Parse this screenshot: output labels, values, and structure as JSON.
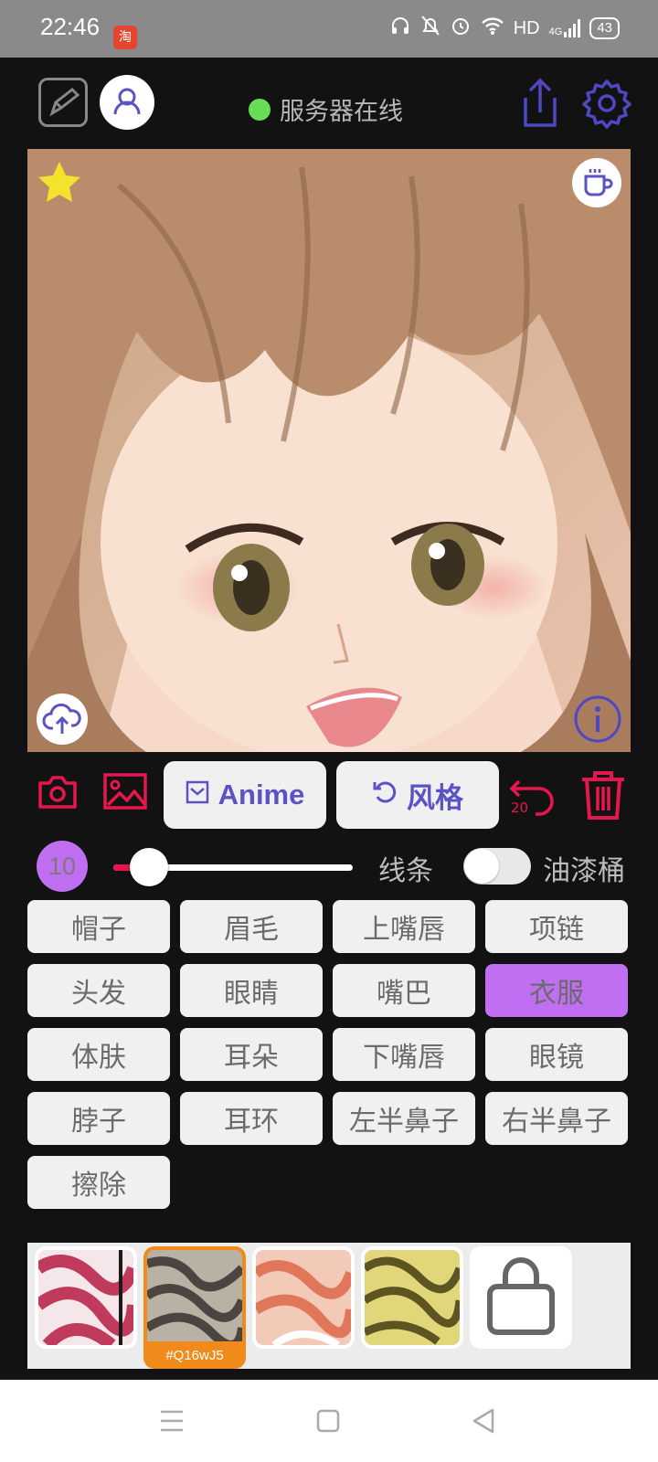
{
  "status_bar": {
    "time": "22:46",
    "app_icon_char": "淘",
    "network_label": "HD",
    "signal_label": "4G",
    "battery": "43"
  },
  "header": {
    "server_status": "服务器在线",
    "server_status_color": "#66dd55"
  },
  "colors": {
    "accent_blue": "#5b53c4",
    "accent_red": "#e8164d",
    "accent_purple": "#c06ef2",
    "swatch_label_orange": "#f08a1a"
  },
  "tools": {
    "mode_button_label": "Anime",
    "style_button_label": "风格",
    "undo_count": "20"
  },
  "brush": {
    "size": "10",
    "line_label": "线条",
    "bucket_label": "油漆桶"
  },
  "parts": [
    {
      "label": "帽子",
      "active": false
    },
    {
      "label": "眉毛",
      "active": false
    },
    {
      "label": "上嘴唇",
      "active": false
    },
    {
      "label": "项链",
      "active": false
    },
    {
      "label": "头发",
      "active": false
    },
    {
      "label": "眼睛",
      "active": false
    },
    {
      "label": "嘴巴",
      "active": false
    },
    {
      "label": "衣服",
      "active": true
    },
    {
      "label": "体肤",
      "active": false
    },
    {
      "label": "耳朵",
      "active": false
    },
    {
      "label": "下嘴唇",
      "active": false
    },
    {
      "label": "眼镜",
      "active": false
    },
    {
      "label": "脖子",
      "active": false
    },
    {
      "label": "耳环",
      "active": false
    },
    {
      "label": "左半鼻子",
      "active": false
    },
    {
      "label": "右半鼻子",
      "active": false
    },
    {
      "label": "擦除",
      "active": false
    }
  ],
  "textures": {
    "selected_code": "#Q16wJ5"
  }
}
